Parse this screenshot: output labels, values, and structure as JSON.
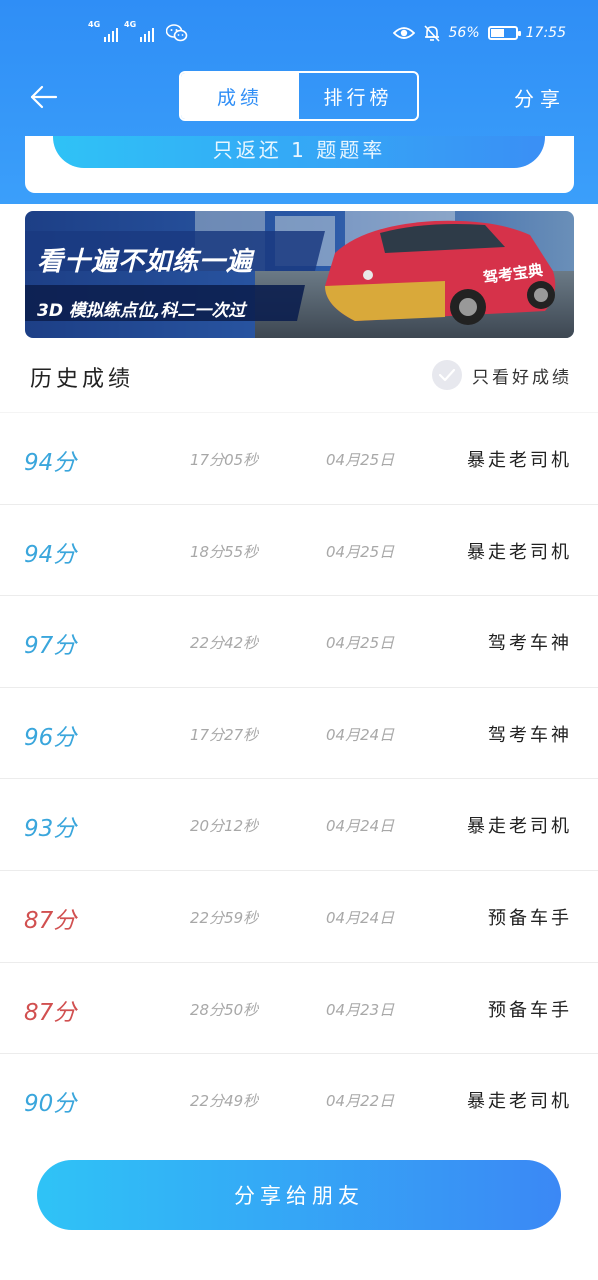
{
  "status_bar": {
    "network_1": "4G",
    "network_2": "4G",
    "battery_percent": "56%",
    "battery_level": 0.56,
    "time": "17:55"
  },
  "nav": {
    "tabs": [
      {
        "label": "成绩",
        "active": true
      },
      {
        "label": "排行榜",
        "active": false
      }
    ],
    "share_label": "分享"
  },
  "top_card": {
    "button_label": "只返还 1 题题率"
  },
  "banner": {
    "headline": "看十遍不如练一遍",
    "subline": "3D 模拟练点位,科二一次过",
    "car_door_text": "驾考宝典"
  },
  "history": {
    "title": "历史成绩",
    "filter_label": "只看好成绩",
    "records": [
      {
        "score": "94分",
        "time": "17分05秒",
        "date": "04月25日",
        "rank": "暴走老司机",
        "color": "blue"
      },
      {
        "score": "94分",
        "time": "18分55秒",
        "date": "04月25日",
        "rank": "暴走老司机",
        "color": "blue"
      },
      {
        "score": "97分",
        "time": "22分42秒",
        "date": "04月25日",
        "rank": "驾考车神",
        "color": "blue"
      },
      {
        "score": "96分",
        "time": "17分27秒",
        "date": "04月24日",
        "rank": "驾考车神",
        "color": "blue"
      },
      {
        "score": "93分",
        "time": "20分12秒",
        "date": "04月24日",
        "rank": "暴走老司机",
        "color": "blue"
      },
      {
        "score": "87分",
        "time": "22分59秒",
        "date": "04月24日",
        "rank": "预备车手",
        "color": "red"
      },
      {
        "score": "87分",
        "time": "28分50秒",
        "date": "04月23日",
        "rank": "预备车手",
        "color": "red"
      },
      {
        "score": "90分",
        "time": "22分49秒",
        "date": "04月22日",
        "rank": "暴走老司机",
        "color": "blue"
      }
    ]
  },
  "footer": {
    "share_button": "分享给朋友"
  },
  "colors": {
    "header_blue": "#2f8ef6",
    "score_blue": "#3aa6dc",
    "score_red": "#d15050"
  }
}
